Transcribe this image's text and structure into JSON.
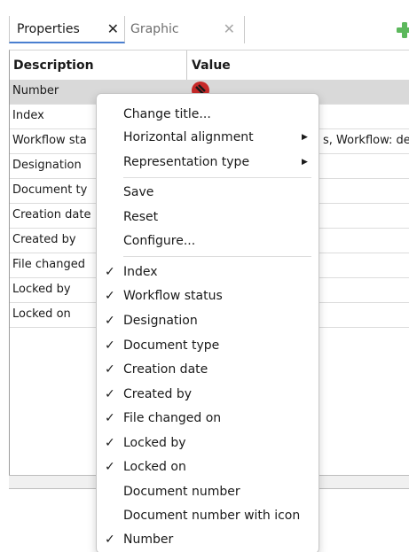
{
  "tabs": [
    {
      "label": "Properties",
      "close": "✕"
    },
    {
      "label": "Graphic",
      "close": "✕"
    }
  ],
  "toolbar": {
    "add_icon": "green-plus-icon",
    "add_color": "#5cb85c"
  },
  "table": {
    "headers": {
      "description": "Description",
      "value": "Value"
    },
    "rows": [
      {
        "description": "Number",
        "value": ""
      },
      {
        "description": "Index",
        "value": ""
      },
      {
        "description": "Workflow sta",
        "value": "s, Workflow: de"
      },
      {
        "description": "Designation",
        "value": ""
      },
      {
        "description": "Document ty",
        "value": ""
      },
      {
        "description": "Creation date",
        "value": ""
      },
      {
        "description": "Created by",
        "value": ""
      },
      {
        "description": "File changed",
        "value": ""
      },
      {
        "description": "Locked by",
        "value": ""
      },
      {
        "description": "Locked on",
        "value": ""
      }
    ],
    "value_icon": "red-document-number-icon"
  },
  "menu": {
    "items": [
      {
        "label": "Change title...",
        "checked": false,
        "submenu": false
      },
      {
        "label": "Horizontal alignment",
        "checked": false,
        "submenu": true
      },
      {
        "label": "Representation type",
        "checked": false,
        "submenu": true
      },
      {
        "label": "Save",
        "checked": false,
        "submenu": false
      },
      {
        "label": "Reset",
        "checked": false,
        "submenu": false
      },
      {
        "label": "Configure...",
        "checked": false,
        "submenu": false
      },
      {
        "label": "Index",
        "checked": true,
        "submenu": false
      },
      {
        "label": "Workflow status",
        "checked": true,
        "submenu": false
      },
      {
        "label": "Designation",
        "checked": true,
        "submenu": false
      },
      {
        "label": "Document type",
        "checked": true,
        "submenu": false
      },
      {
        "label": "Creation date",
        "checked": true,
        "submenu": false
      },
      {
        "label": "Created by",
        "checked": true,
        "submenu": false
      },
      {
        "label": "File changed on",
        "checked": true,
        "submenu": false
      },
      {
        "label": "Locked by",
        "checked": true,
        "submenu": false
      },
      {
        "label": "Locked on",
        "checked": true,
        "submenu": false
      },
      {
        "label": "Document number",
        "checked": false,
        "submenu": false
      },
      {
        "label": "Document number with icon",
        "checked": false,
        "submenu": false
      },
      {
        "label": "Number",
        "checked": true,
        "submenu": false
      }
    ],
    "check_glyph": "✓",
    "arrow_glyph": "▶"
  }
}
